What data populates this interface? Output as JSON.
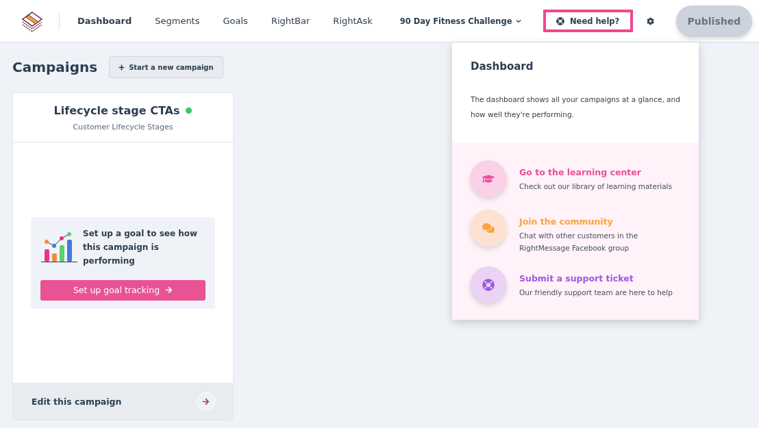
{
  "nav": {
    "items": [
      {
        "label": "Dashboard",
        "selected": true
      },
      {
        "label": "Segments",
        "selected": false
      },
      {
        "label": "Goals",
        "selected": false
      },
      {
        "label": "RightBar",
        "selected": false
      },
      {
        "label": "RightAsk",
        "selected": false
      }
    ],
    "site": "90 Day Fitness Challenge",
    "help": "Need help?",
    "help_highlighted": true,
    "publish": "Published"
  },
  "page": {
    "title": "Campaigns",
    "new_button": "Start a new campaign"
  },
  "campaigns": [
    {
      "name": "Lifecycle stage CTAs",
      "live": true,
      "subtitle": "Customer Lifecycle Stages",
      "goal_prompt": "Set up a goal to see how this campaign is performing",
      "goal_button": "Set up goal tracking",
      "edit": "Edit this campaign"
    }
  ],
  "help_panel": {
    "title": "Dashboard",
    "text": "The dashboard shows all your campaigns at a glance, and how well they're performing.",
    "resources": [
      {
        "kind": "learning",
        "color": "#e8509a",
        "title": "Go to the learning center",
        "text": "Check out our library of learning materials"
      },
      {
        "kind": "community",
        "color": "#f7a440",
        "title": "Join the community",
        "text": "Chat with other customers in the RightMessage Facebook group"
      },
      {
        "kind": "support",
        "color": "#9b59e0",
        "title": "Submit a support ticket",
        "text": "Our friendly support team are here to help"
      }
    ]
  }
}
